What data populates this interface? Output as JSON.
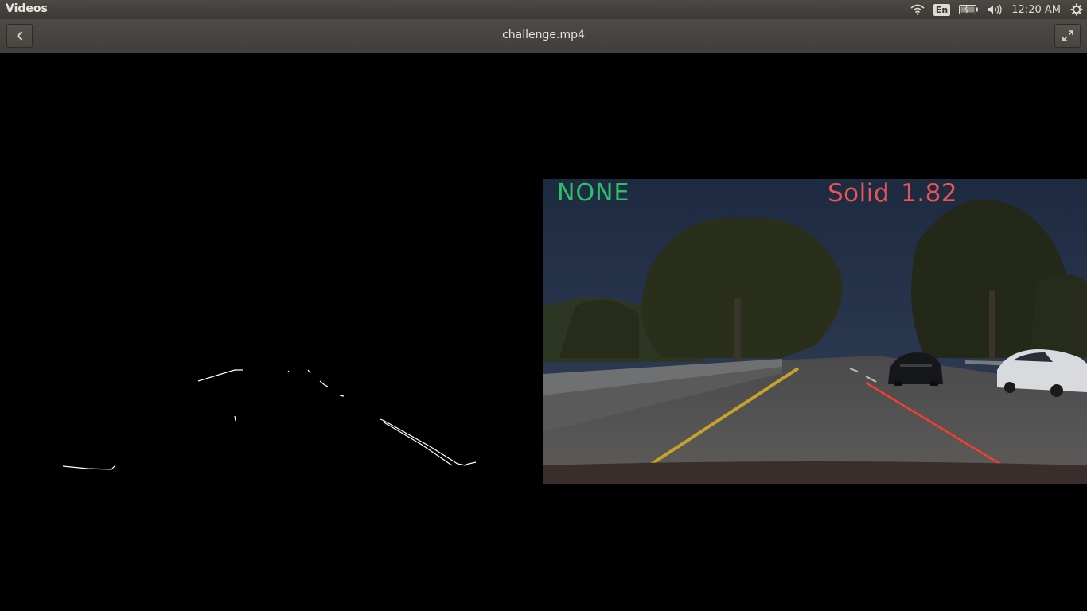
{
  "panel": {
    "app_title": "Videos",
    "keyboard_layout": "En",
    "clock": "12:20 AM",
    "icons": [
      "wifi-icon",
      "keyboard-layout-indicator",
      "battery-icon",
      "volume-icon",
      "gear-icon"
    ]
  },
  "headerbar": {
    "title": "challenge.mp4",
    "back_icon": "chevron-left-icon",
    "fullscreen_icon": "fullscreen-icon"
  },
  "video": {
    "left_label": "NONE",
    "right_label_type": "Solid",
    "right_label_value": "1.82",
    "colors": {
      "left_label": "#2bc16b",
      "right_label": "#e85458",
      "lane_line": "#ff3b2a",
      "yellow_line": "#c9a22a"
    }
  }
}
